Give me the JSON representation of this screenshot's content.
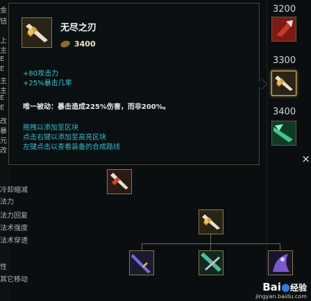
{
  "app": {
    "accent": "#d4b45a",
    "tooltip_border": "#4a4632",
    "stat_color": "#3ec3c8"
  },
  "left_panel": {
    "top_labels": [
      "金",
      "钮",
      "上",
      "主",
      "E",
      "E",
      "主",
      "主",
      "E",
      "E",
      "改",
      "暴",
      "元",
      "改"
    ],
    "stats": [
      "冷却缩减",
      "法力",
      "法力回复",
      "法术强度",
      "法术穿透",
      "",
      "其它移动"
    ],
    "stat_partial": "性"
  },
  "right_column": {
    "prices": [
      "3200",
      "3300",
      "3400"
    ],
    "items": [
      {
        "icon": "dragon-axe-icon"
      },
      {
        "icon": "infinity-edge-icon",
        "selected": true
      },
      {
        "icon": "green-blade-icon"
      }
    ],
    "close": "×"
  },
  "tooltip": {
    "icon": "infinity-edge-icon",
    "title": "无尽之刃",
    "cost_icon": "gold-coin-icon",
    "cost": "3400",
    "stats": [
      "+80攻击力",
      "+25%暴击几率"
    ],
    "passive": "唯一被动：暴击造成225%伤害，而非200%。",
    "hints": [
      "拖拽以添加至区块",
      "点击右键以添加至高亮区块",
      "左键点击以查看装备的合成路线"
    ]
  },
  "recipe": {
    "main_item": {
      "icon": "infinity-edge-icon"
    },
    "parent": {
      "icon": "infinity-edge-icon"
    },
    "children": [
      {
        "icon": "bf-sword-icon"
      },
      {
        "icon": "pickaxe-icon"
      },
      {
        "icon": "cloak-of-agility-icon"
      }
    ]
  },
  "watermark": {
    "brand": "Bai",
    "brand_zh": "经验",
    "url": "jingyan.baidu.com"
  }
}
